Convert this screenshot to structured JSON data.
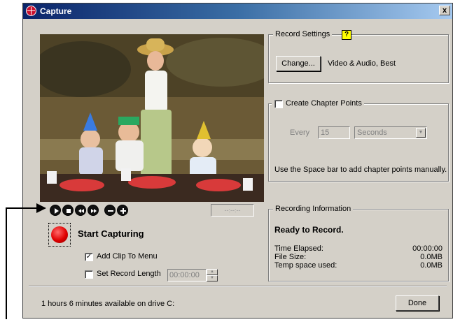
{
  "window": {
    "title": "Capture",
    "close_label": "x"
  },
  "transport": {
    "buttons": [
      "play-icon",
      "stop-icon",
      "rewind-icon",
      "fast-forward-icon",
      "zoom-out-icon",
      "zoom-in-icon"
    ],
    "timecode": "--:--:--"
  },
  "capture": {
    "start_label": "Start Capturing",
    "add_clip_label": "Add Clip To Menu",
    "add_clip_checked": true,
    "set_length_label": "Set Record Length",
    "set_length_checked": false,
    "length_value": "00:00:00"
  },
  "record_settings": {
    "title": "Record Settings",
    "help_label": "?",
    "change_label": "Change...",
    "value": "Video & Audio, Best"
  },
  "chapter_points": {
    "title": "Create Chapter Points",
    "checked": false,
    "every_label": "Every",
    "every_value": "15",
    "unit_value": "Seconds",
    "hint": "Use the Space bar to add chapter points manually."
  },
  "recording_info": {
    "title": "Recording Information",
    "status": "Ready to Record.",
    "rows": [
      {
        "label": "Time Elapsed:",
        "value": "00:00:00"
      },
      {
        "label": "File Size:",
        "value": "0.0MB"
      },
      {
        "label": "Temp space used:",
        "value": "0.0MB"
      }
    ]
  },
  "footer": {
    "status": "1 hours 6 minutes available on drive C:",
    "done_label": "Done"
  },
  "colors": {
    "title_bar": "#0a246a",
    "face": "#d4d0c8",
    "record": "#e00000",
    "help": "#ffff00"
  }
}
